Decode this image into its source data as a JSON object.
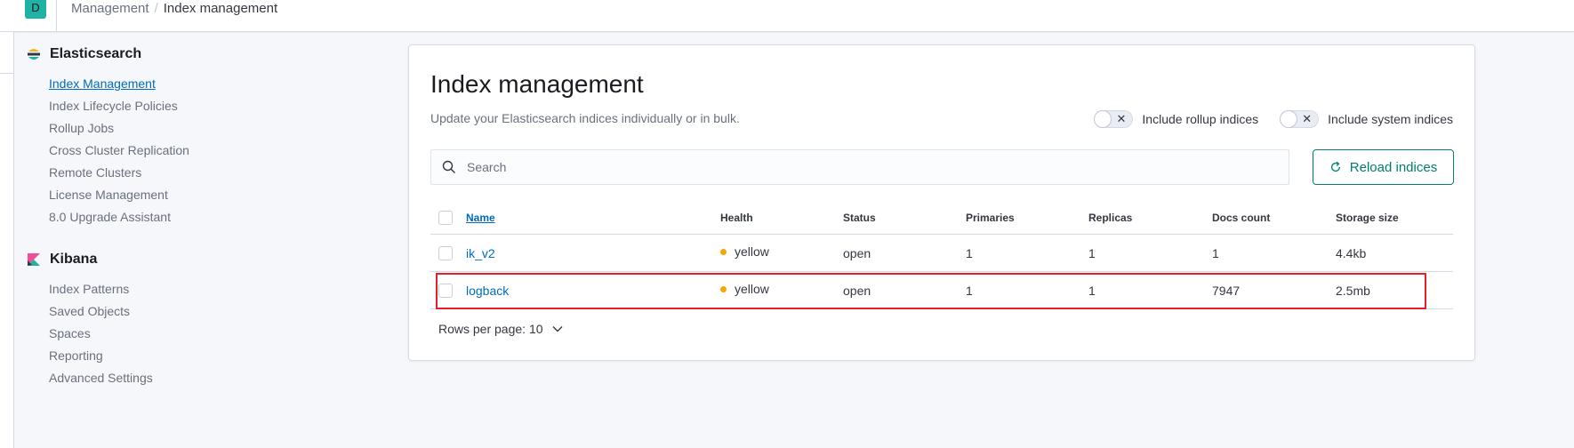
{
  "header": {
    "avatar_letter": "D",
    "breadcrumb": [
      "Management",
      "Index management"
    ]
  },
  "sidebar": {
    "groups": [
      {
        "title": "Elasticsearch",
        "icon": "elasticsearch-logo-icon",
        "items": [
          {
            "label": "Index Management",
            "active": true
          },
          {
            "label": "Index Lifecycle Policies"
          },
          {
            "label": "Rollup Jobs"
          },
          {
            "label": "Cross Cluster Replication"
          },
          {
            "label": "Remote Clusters"
          },
          {
            "label": "License Management"
          },
          {
            "label": "8.0 Upgrade Assistant"
          }
        ]
      },
      {
        "title": "Kibana",
        "icon": "kibana-logo-icon",
        "items": [
          {
            "label": "Index Patterns"
          },
          {
            "label": "Saved Objects"
          },
          {
            "label": "Spaces"
          },
          {
            "label": "Reporting"
          },
          {
            "label": "Advanced Settings"
          }
        ]
      }
    ]
  },
  "main": {
    "title": "Index management",
    "subtitle": "Update your Elasticsearch indices individually or in bulk.",
    "toggles": [
      {
        "label": "Include rollup indices",
        "on": false
      },
      {
        "label": "Include system indices",
        "on": false
      }
    ],
    "search_placeholder": "Search",
    "reload_label": "Reload indices",
    "columns": [
      "Name",
      "Health",
      "Status",
      "Primaries",
      "Replicas",
      "Docs count",
      "Storage size"
    ],
    "rows": [
      {
        "name": "ik_v2",
        "health": "yellow",
        "status": "open",
        "primaries": "1",
        "replicas": "1",
        "docs_count": "1",
        "storage_size": "4.4kb",
        "highlighted": false
      },
      {
        "name": "logback",
        "health": "yellow",
        "status": "open",
        "primaries": "1",
        "replicas": "1",
        "docs_count": "7947",
        "storage_size": "2.5mb",
        "highlighted": true
      }
    ],
    "rows_per_page": "Rows per page: 10"
  },
  "colors": {
    "accent": "#006bb8",
    "primary_button": "#017d73",
    "health_yellow": "#f5a700",
    "highlight_box": "#e5202b"
  }
}
